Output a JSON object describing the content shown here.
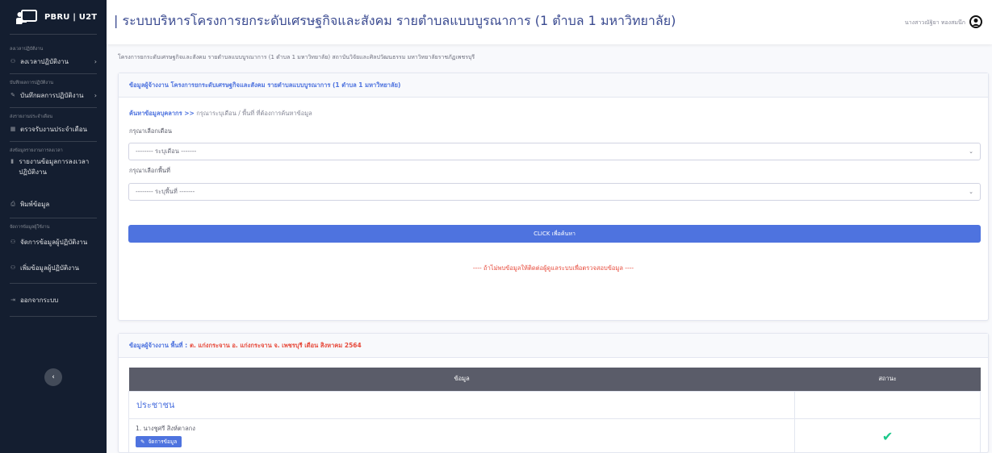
{
  "brand": {
    "name": "PBRU | U2T"
  },
  "sidebar": {
    "sections": [
      {
        "heading": "ลงเวลาปฏิบัติงาน",
        "item": "ลงเวลาปฏิบัติงาน"
      },
      {
        "heading": "บันทึกผลการปฏิบัติงาน",
        "item": "บันทึกผลการปฏิบัติงาน"
      },
      {
        "heading": "ส่งรายงานประจำเดือน",
        "item": "ตรวจรับงานประจำเดือน"
      },
      {
        "heading": "ส่งข้อมูลรายงานการลงเวลา",
        "item": "รายงานข้อมูลการลงเวลาปฏิบัติงาน"
      },
      {
        "heading": "",
        "item": "พิมพ์ข้อมูล"
      },
      {
        "heading": "จัดการข้อมูลผู้ใช้งาน",
        "item": "จัดการข้อมูลผู้ปฏิบัติงาน"
      },
      {
        "heading": "",
        "item": "เพิ่มข้อมูลผู้ปฏิบัติงาน"
      },
      {
        "heading": "",
        "item": "ออกจากระบบ"
      }
    ],
    "toggle_label": "‹"
  },
  "header": {
    "title": "| ระบบบริหารโครงการยกระดับเศรษฐกิจและสังคม รายตำบลแบบบูรณาการ (1 ตำบล 1 มหาวิทยาลัย)",
    "user_name": "นางสาวณัฐิยา ทองสมนึก"
  },
  "breadcrumb": "โครงการยกระดับเศรษฐกิจและสังคม รายตำบลแบบบูรณาการ (1 ตำบล 1 มหาวิทยาลัย) สถาบันวิจัยและศิลปวัฒนธรรม มหาวิทยาลัยราชภัฏเพชรบุรี",
  "search_card": {
    "header": "ข้อมูลผู้จ้างงาน โครงการยกระดับเศรษฐกิจและสังคม รายตำบลแบบบูรณาการ (1 ตำบล 1 มหาวิทยาลัย)",
    "search_prefix": "ค้นหาข้อมูลบุคลากร >>",
    "search_hint": "กรุณาระบุเดือน / พื้นที่ ที่ต้องการค้นหาข้อมูล",
    "month_label": "กรุณาเลือกเดือน",
    "month_value": "-------- ระบุเดือน -------",
    "area_label": "กรุณาเลือกพื้นที่",
    "area_value": "-------- ระบุพื้นที่ -------",
    "search_button": "CLICK เพื่อค้นหา",
    "notice": "---- ถ้าไม่พบข้อมูลให้ติดต่อผู้ดูแลระบบเพื่อตรวจสอบข้อมูล ----"
  },
  "result_card": {
    "header_prefix": "ข้อมูลผู้จ้างงาน พื้นที่ :",
    "header_area": "ต. แก่งกระจาน อ. แก่งกระจาน จ. เพชรบุรี เดือน สิงหาคม 2564",
    "columns": [
      "ข้อมูล",
      "สถานะ"
    ],
    "group": "ประชาชน",
    "rows": [
      {
        "name": "1. นางชูศรี สิงห์ตาลกง",
        "action": "จัดการข้อมูล",
        "status": "✔"
      }
    ]
  },
  "colors": {
    "sidebar": "#141e30",
    "primary": "#4e73df",
    "danger": "#e74a3b",
    "success": "#1cc88a"
  }
}
